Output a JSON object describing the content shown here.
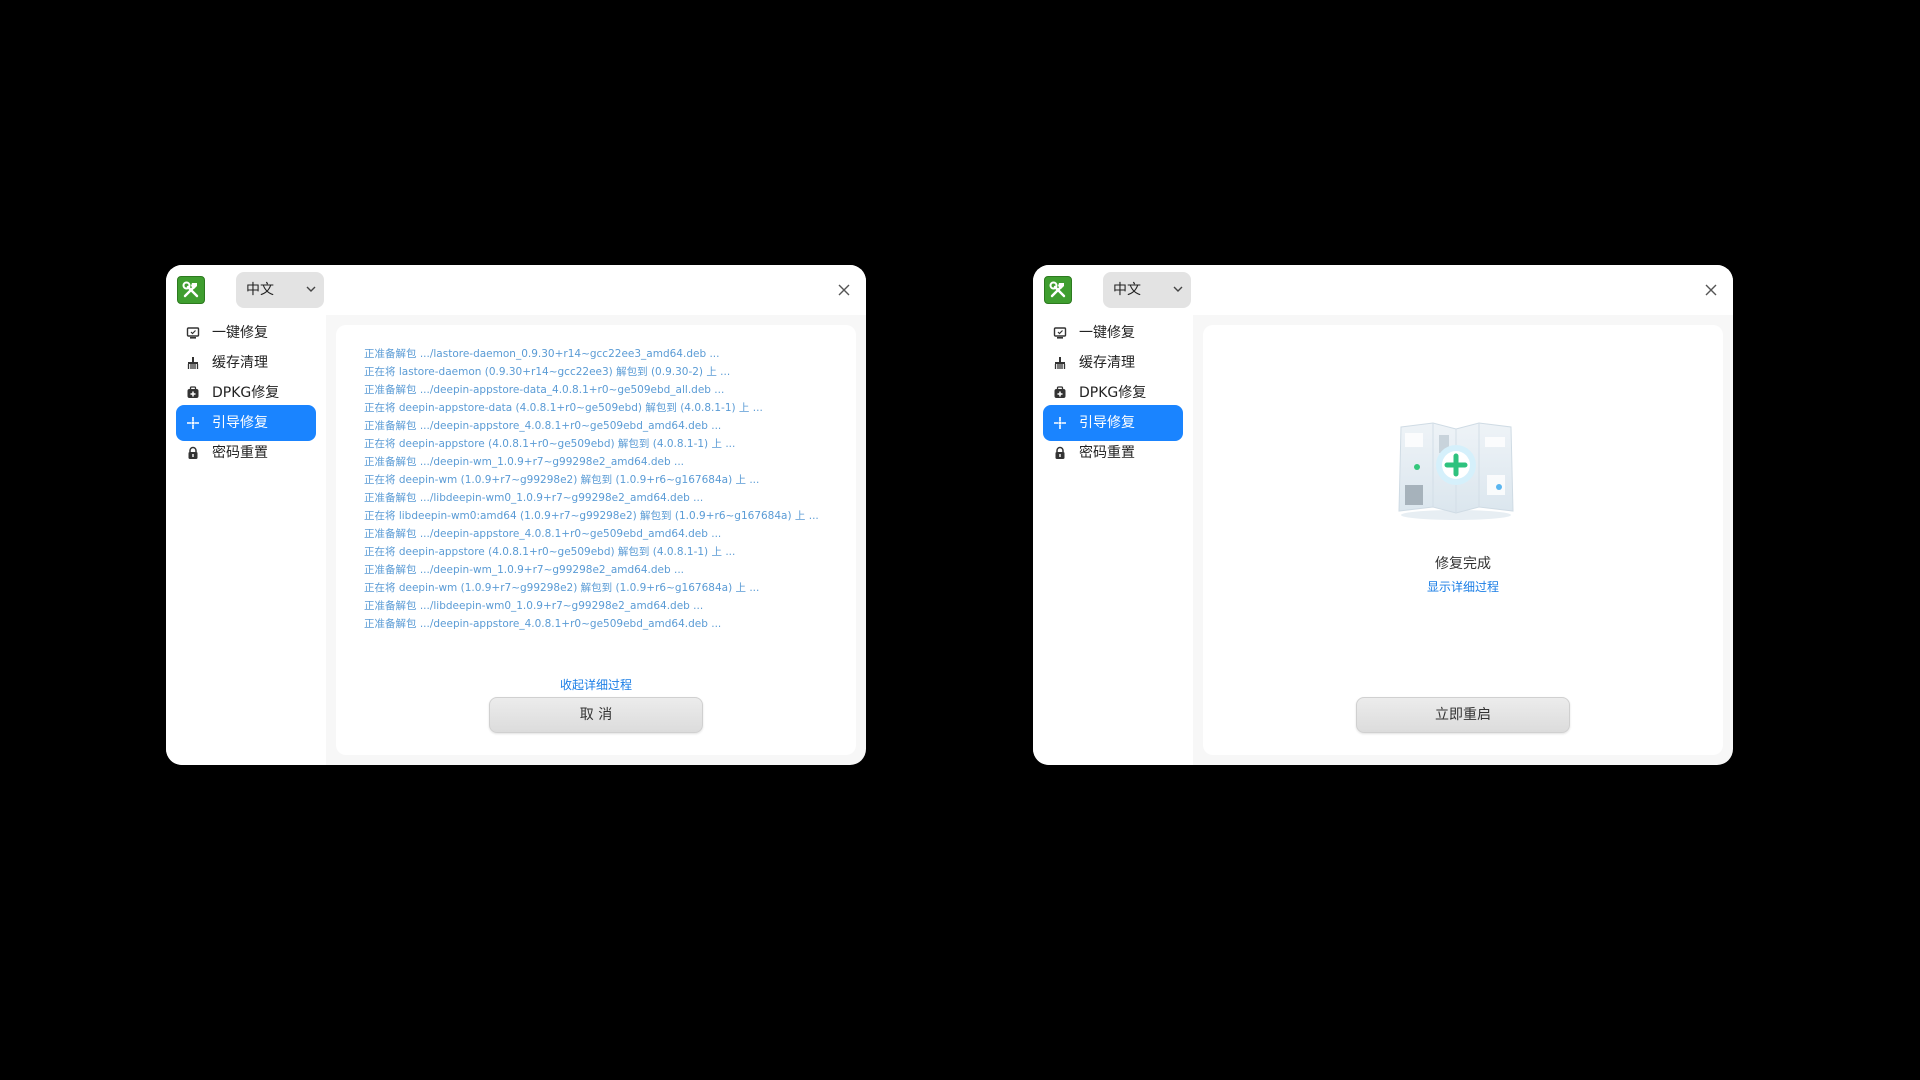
{
  "left": {
    "language": "中文",
    "nav": [
      {
        "label": "一键修复",
        "icon": "monitor-repair-icon"
      },
      {
        "label": "缓存清理",
        "icon": "broom-icon"
      },
      {
        "label": "DPKG修复",
        "icon": "package-repair-icon"
      },
      {
        "label": "引导修复",
        "icon": "boot-repair-icon"
      },
      {
        "label": "密码重置",
        "icon": "lock-icon"
      }
    ],
    "active_nav": "引导修复",
    "log": [
      "正准备解包 .../lastore-daemon_0.9.30+r14~gcc22ee3_amd64.deb  ...",
      "正在将 lastore-daemon (0.9.30+r14~gcc22ee3) 解包到 (0.9.30-2) 上 ...",
      "正准备解包 .../deepin-appstore-data_4.0.8.1+r0~ge509ebd_all.deb  ...",
      "正在将 deepin-appstore-data (4.0.8.1+r0~ge509ebd) 解包到 (4.0.8.1-1) 上 ...",
      "正准备解包 .../deepin-appstore_4.0.8.1+r0~ge509ebd_amd64.deb  ...",
      "正在将 deepin-appstore (4.0.8.1+r0~ge509ebd) 解包到 (4.0.8.1-1) 上 ...",
      "正准备解包 .../deepin-wm_1.0.9+r7~g99298e2_amd64.deb  ...",
      "正在将 deepin-wm (1.0.9+r7~g99298e2) 解包到 (1.0.9+r6~g167684a) 上 ...",
      "正准备解包 .../libdeepin-wm0_1.0.9+r7~g99298e2_amd64.deb  ...",
      "正在将 libdeepin-wm0:amd64 (1.0.9+r7~g99298e2) 解包到 (1.0.9+r6~g167684a) 上 ...",
      "正准备解包 .../deepin-appstore_4.0.8.1+r0~ge509ebd_amd64.deb  ...",
      "正在将 deepin-appstore (4.0.8.1+r0~ge509ebd) 解包到 (4.0.8.1-1) 上 ...",
      "正准备解包 .../deepin-wm_1.0.9+r7~g99298e2_amd64.deb  ...",
      "正在将 deepin-wm (1.0.9+r7~g99298e2) 解包到 (1.0.9+r6~g167684a) 上 ...",
      "正准备解包 .../libdeepin-wm0_1.0.9+r7~g99298e2_amd64.deb  ...",
      "正准备解包 .../deepin-appstore_4.0.8.1+r0~ge509ebd_amd64.deb  ..."
    ],
    "collapse_link": "收起详细过程",
    "cancel_button": "取 消"
  },
  "right": {
    "language": "中文",
    "nav": [
      {
        "label": "一键修复",
        "icon": "monitor-repair-icon"
      },
      {
        "label": "缓存清理",
        "icon": "broom-icon"
      },
      {
        "label": "DPKG修复",
        "icon": "package-repair-icon"
      },
      {
        "label": "引导修复",
        "icon": "boot-repair-icon"
      },
      {
        "label": "密码重置",
        "icon": "lock-icon"
      }
    ],
    "active_nav": "引导修复",
    "done_title": "修复完成",
    "show_details_link": "显示详细过程",
    "restart_button": "立即重启"
  },
  "colors": {
    "accent": "#1a84ff",
    "log_text": "#5a9bd5",
    "link": "#1a7ee6",
    "logo_green": "#3f9e2f",
    "illustration_green": "#2ec27e"
  }
}
